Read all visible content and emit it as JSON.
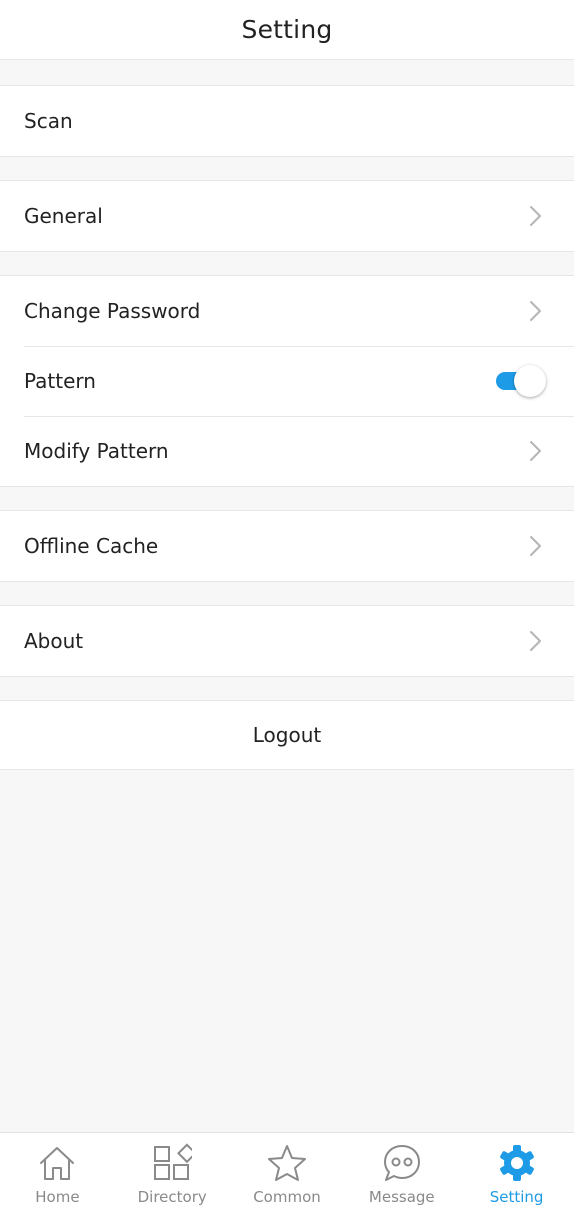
{
  "header": {
    "title": "Setting"
  },
  "groups": {
    "scan": {
      "label": "Scan"
    },
    "general": {
      "label": "General"
    },
    "security": {
      "change_password": "Change Password",
      "pattern": "Pattern",
      "pattern_enabled": true,
      "modify_pattern": "Modify Pattern"
    },
    "offline_cache": {
      "label": "Offline Cache"
    },
    "about": {
      "label": "About"
    }
  },
  "logout": {
    "label": "Logout"
  },
  "tabbar": {
    "tabs": [
      {
        "label": "Home",
        "icon": "home-icon"
      },
      {
        "label": "Directory",
        "icon": "grid-icon"
      },
      {
        "label": "Common",
        "icon": "star-icon"
      },
      {
        "label": "Message",
        "icon": "chat-icon"
      },
      {
        "label": "Setting",
        "icon": "gear-icon"
      }
    ],
    "active": "Setting"
  },
  "colors": {
    "accent": "#1e9be6",
    "background": "#f7f7f7",
    "card": "#ffffff",
    "inactive": "#8a8a8a"
  }
}
